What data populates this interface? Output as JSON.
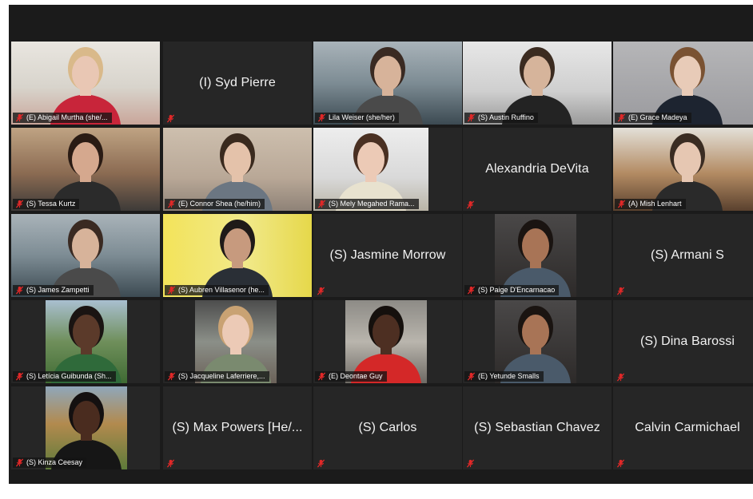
{
  "participants": [
    {
      "name": "(E) Abigail Murtha (she/...",
      "camera": true,
      "scene": "room-bright",
      "active": true
    },
    {
      "name": "(I) Syd Pierre",
      "camera": false
    },
    {
      "name": "Lila Weiser (she/her)",
      "camera": true,
      "scene": "window-office"
    },
    {
      "name": "(S) Austin Ruffino",
      "camera": true,
      "scene": "office-ceiling"
    },
    {
      "name": "(E) Grace Madeya",
      "camera": true,
      "scene": "grey-wall"
    },
    {
      "name": "(S) Tessa Kurtz",
      "camera": true,
      "scene": "window-warm"
    },
    {
      "name": "(E) Connor Shea (he/him)",
      "camera": true,
      "scene": "beige-room"
    },
    {
      "name": "(S) Mely Megahed Rama...",
      "camera": true,
      "scene": "bright-wall"
    },
    {
      "name": "Alexandria DeVita",
      "camera": false
    },
    {
      "name": "(A) Mish Lenhart",
      "camera": true,
      "scene": "window-wood"
    },
    {
      "name": "(S) James Zampetti",
      "camera": true,
      "scene": "window-office"
    },
    {
      "name": "(S) Aubren Villasenor (he...",
      "camera": true,
      "scene": "yellow-wall"
    },
    {
      "name": "(S) Jasmine Morrow",
      "camera": false
    },
    {
      "name": "(S) Paige D'Encarnacao",
      "camera": true,
      "scene": "dark-portrait"
    },
    {
      "name": "(S) Armani S",
      "camera": false
    },
    {
      "name": "(S) Letícia Guibunda  (Sh...",
      "camera": true,
      "scene": "outdoor-green"
    },
    {
      "name": "(S) Jacqueline Laferriere,...",
      "camera": true,
      "scene": "car-interior"
    },
    {
      "name": "(E) Deontae Guy",
      "camera": true,
      "scene": "stairs"
    },
    {
      "name": "(E) Yetunde Smalls",
      "camera": true,
      "scene": "dark-portrait"
    },
    {
      "name": "(S) Dina Barossi",
      "camera": false
    },
    {
      "name": "(S) Kinza Ceesay",
      "camera": true,
      "scene": "autumn-park"
    },
    {
      "name": "(S) Max Powers [He/...",
      "camera": false
    },
    {
      "name": "(S) Carlos",
      "camera": false
    },
    {
      "name": "(S) Sebastian Chavez",
      "camera": false
    },
    {
      "name": "Calvin Carmichael",
      "camera": false
    }
  ],
  "icons": {
    "muted": "mic-muted-icon"
  },
  "colors": {
    "window_bg": "#1b1b1b",
    "tile_bg": "#262626",
    "active_speaker_outline": "#d9dd6b",
    "muted_icon": "#e02828"
  }
}
